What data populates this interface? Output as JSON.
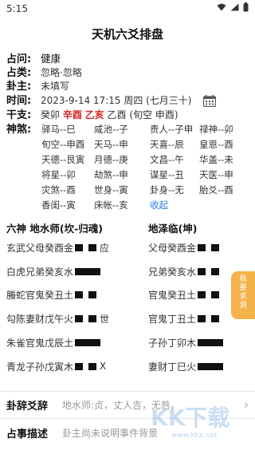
{
  "status": {
    "time": "5:15"
  },
  "title": "天机六爻排盘",
  "info": {
    "zhanwen_label": "占问:",
    "zhanwen_value": "健康",
    "zhanlei_label": "占类:",
    "zhanlei_value": "忽略·忽略",
    "guazhu_label": "卦主:",
    "guazhu_value": "未填写",
    "time_label": "时间:",
    "time_value": "2023-9-14 17:15 周四 (七月三十)",
    "ganzhi_label": "干支:",
    "ganzhi_y": "癸卯",
    "ganzhi_m": "辛酉",
    "ganzhi_d": "乙亥",
    "ganzhi_rest": "乙酉 (旬空 申酉)",
    "shensha_label": "神煞:"
  },
  "shensha": [
    [
      "驿马--巳",
      "咸池--子",
      "贵人--子申",
      "禄神--卯"
    ],
    [
      "旬空--申酉",
      "天马--申",
      "天喜--辰",
      "皇恩--酉"
    ],
    [
      "天德--艮寅",
      "月德--庚",
      "文昌--午",
      "华盖--未"
    ],
    [
      "将星--卯",
      "劫煞--申",
      "谋星--丑",
      "天医--申"
    ],
    [
      "灾煞--酉",
      "世身--寅",
      "卦身--无",
      "胎爻--酉"
    ],
    [
      "香闺--寅",
      "床帐--亥",
      "收起"
    ]
  ],
  "hexagram": {
    "header_left": "六神 地水师(坎-归魂)",
    "header_right": "地泽临(坤)",
    "rows": [
      {
        "shen": "玄武",
        "left": "父母癸酉金",
        "mark": "应",
        "right": "父母癸酉金"
      },
      {
        "shen": "白虎",
        "left": "兄弟癸亥水",
        "mark": "",
        "right": "兄弟癸亥水"
      },
      {
        "shen": "螣蛇",
        "left": "官鬼癸丑土",
        "mark": "",
        "right": "官鬼癸丑土"
      },
      {
        "shen": "勾陈",
        "left": "妻财戊午火",
        "mark": "世",
        "right": "官鬼丁丑土"
      },
      {
        "shen": "朱雀",
        "left": "官鬼戊辰土",
        "mark": "",
        "right": "子孙丁卯木"
      },
      {
        "shen": "青龙",
        "left": "子孙戊寅木",
        "mark": "X",
        "right": "妻财丁巳火"
      }
    ]
  },
  "side_tab": "我要求测",
  "bottom": {
    "guaci_label": "卦辞爻辞",
    "guaci_value": "地水师:贞，丈人吉，无咎。",
    "shishi_label": "占事描述",
    "shishi_value": "卦主尚未说明事件背景"
  },
  "watermark": "KK下载",
  "watermark_url": "www.kkx.net"
}
